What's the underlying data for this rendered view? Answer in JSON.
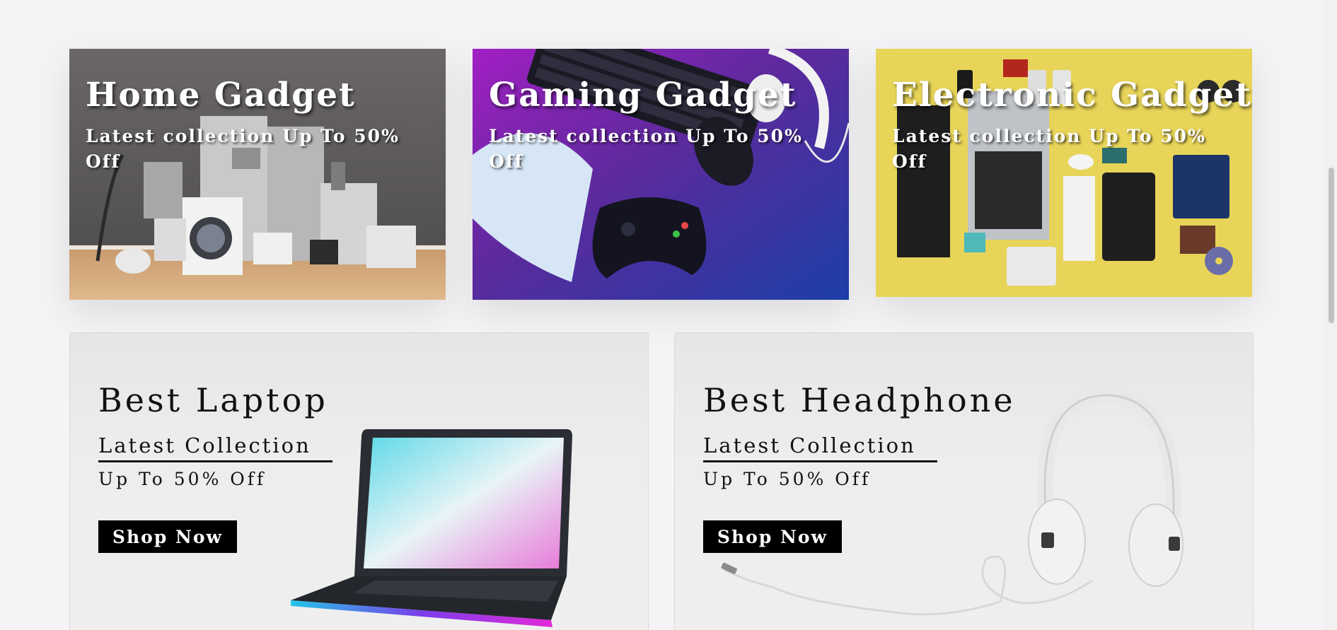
{
  "categories": [
    {
      "title": "Home Gadget",
      "subtitle": "Latest collection Up To 50% Off"
    },
    {
      "title": "Gaming Gadget",
      "subtitle": "Latest collection Up To 50% Off"
    },
    {
      "title": "Electronic Gadget",
      "subtitle": "Latest collection Up To 50% Off"
    }
  ],
  "promos": [
    {
      "title": "Best Laptop",
      "collection": "Latest Collection",
      "offer": "Up To 50% Off",
      "button": "Shop Now"
    },
    {
      "title": "Best Headphone",
      "collection": "Latest Collection",
      "offer": "Up To 50% Off",
      "button": "Shop Now"
    }
  ],
  "colors": {
    "page_bg": "#f4f4f6",
    "button_bg": "#000000",
    "button_text": "#ffffff",
    "gaming_magenta": "#c21bd6",
    "gaming_blue": "#1f4fb8",
    "electronic_yellow": "#e8d44f"
  }
}
